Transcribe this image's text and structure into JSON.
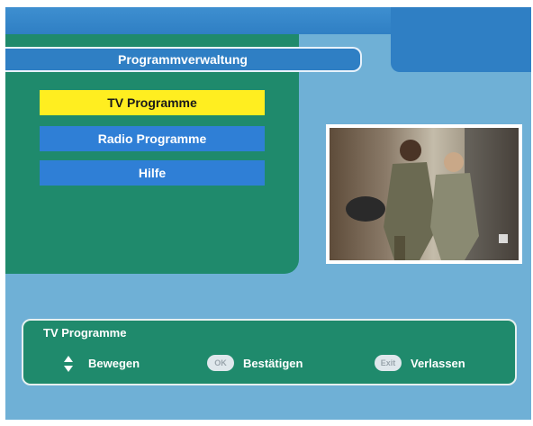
{
  "header": {
    "title": "Programmverwaltung"
  },
  "menu": {
    "items": [
      {
        "label": "TV Programme",
        "selected": true
      },
      {
        "label": "Radio Programme",
        "selected": false
      },
      {
        "label": "Hilfe",
        "selected": false
      }
    ]
  },
  "info": {
    "title": "TV Programme",
    "hints": {
      "move_label": "Bewegen",
      "ok_key": "OK",
      "confirm_label": "Bestätigen",
      "exit_key": "Exit",
      "exit_label": "Verlassen"
    }
  },
  "icons": {
    "move": "up-down-arrows-icon",
    "ok": "ok-button-icon",
    "exit": "exit-button-icon"
  },
  "colors": {
    "background": "#6fb0d6",
    "panel_green": "#1f8a6c",
    "accent_blue": "#2f7fc4",
    "selected_yellow": "#ffee20"
  }
}
